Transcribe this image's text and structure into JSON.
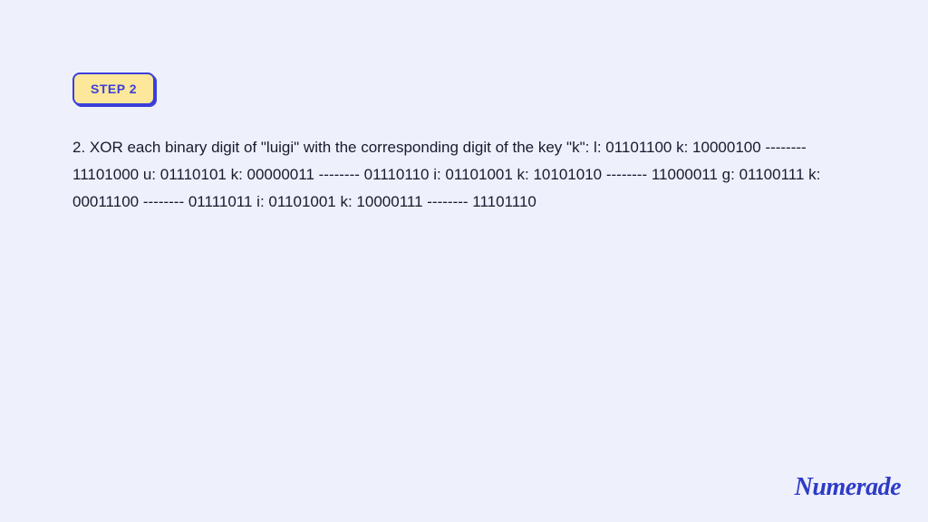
{
  "step": {
    "badge_label": "STEP 2",
    "body_text": "2. XOR each binary digit of \"luigi\" with the corresponding digit of the key \"k\": l: 01101100 k: 10000100 -------- 11101000 u: 01110101 k: 00000011 -------- 01110110 i: 01101001 k: 10101010 -------- 11000011 g: 01100111 k: 00011100 -------- 01111011 i: 01101001 k: 10000111 -------- 11101110"
  },
  "brand": {
    "name": "Numerade"
  }
}
